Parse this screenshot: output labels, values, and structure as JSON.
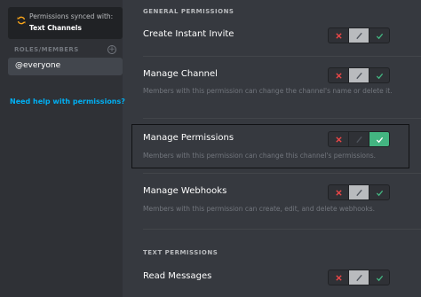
{
  "colors": {
    "background": "#36393f",
    "sidebar": "#2f3136",
    "deny": "#f04747",
    "allow": "#43b581",
    "link": "#00b0f4"
  },
  "sidebar": {
    "sync_line1": "Permissions synced with:",
    "sync_line2": "Text Channels",
    "sync_icon": "sync-icon",
    "roles_header": "ROLES/MEMBERS",
    "add_icon": "plus-circle-icon",
    "selected_role": "@everyone",
    "help_link": "Need help with permissions?"
  },
  "sections": [
    {
      "header": "GENERAL PERMISSIONS",
      "permissions": [
        {
          "name": "Create Instant Invite",
          "description": "",
          "state": "inherit"
        },
        {
          "name": "Manage Channel",
          "description": "Members with this permission can change the channel's name or delete it.",
          "state": "inherit"
        },
        {
          "name": "Manage Permissions",
          "description": "Members with this permission can change this channel's permissions.",
          "state": "allow"
        },
        {
          "name": "Manage Webhooks",
          "description": "Members with this permission can create, edit, and delete webhooks.",
          "state": "inherit"
        }
      ]
    },
    {
      "header": "TEXT PERMISSIONS",
      "permissions": [
        {
          "name": "Read Messages",
          "description": "",
          "state": "inherit"
        }
      ]
    }
  ]
}
